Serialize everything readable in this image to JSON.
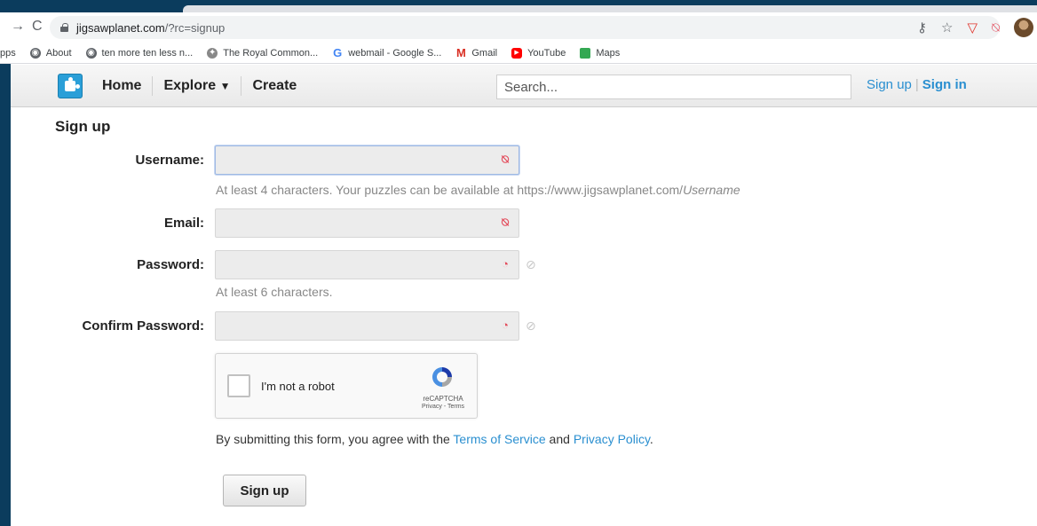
{
  "browser": {
    "url_host": "jigsawplanet.com",
    "url_path": "/?rc=signup",
    "bookmarks": [
      {
        "label": "pps",
        "icon": "apps-icon"
      },
      {
        "label": "About",
        "icon": "globe-icon"
      },
      {
        "label": "ten more ten less n...",
        "icon": "globe-icon"
      },
      {
        "label": "The Royal Common...",
        "icon": "crest-icon"
      },
      {
        "label": "webmail - Google S...",
        "icon": "google-icon"
      },
      {
        "label": "Gmail",
        "icon": "gmail-icon"
      },
      {
        "label": "YouTube",
        "icon": "youtube-icon"
      },
      {
        "label": "Maps",
        "icon": "maps-icon"
      }
    ]
  },
  "header": {
    "nav": [
      "Home",
      "Explore",
      "Create"
    ],
    "explore_caret": "▼",
    "search_placeholder": "Search...",
    "signup_link": "Sign up",
    "signin_link": "Sign in"
  },
  "form": {
    "title": "Sign up",
    "username_label": "Username:",
    "username_hint_prefix": "At least 4 characters. Your puzzles can be available at https://www.jigsawplanet.com/",
    "username_hint_var": "Username",
    "email_label": "Email:",
    "password_label": "Password:",
    "password_hint": "At least 6 characters.",
    "confirm_label": "Confirm Password:",
    "recaptcha_label": "I'm not a robot",
    "recaptcha_brand": "reCAPTCHA",
    "recaptcha_terms": "Privacy - Terms",
    "agree_prefix": "By submitting this form, you agree with the ",
    "tos_link": "Terms of Service",
    "agree_and": " and ",
    "privacy_link": "Privacy Policy",
    "agree_suffix": ".",
    "submit_label": "Sign up"
  },
  "colors": {
    "frame_bg": "#0b3c5d",
    "link": "#2a8fd0",
    "logo": "#2a9fd8",
    "field_icon": "#e34b5b"
  }
}
